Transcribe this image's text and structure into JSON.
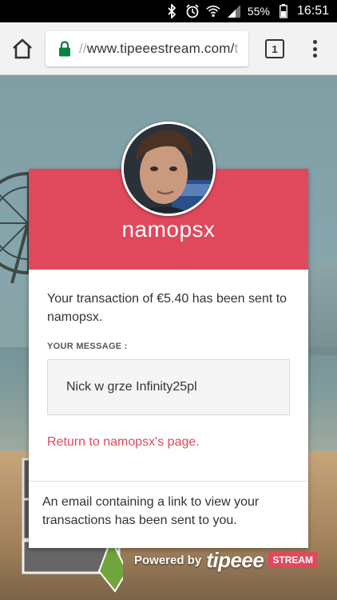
{
  "status_bar": {
    "battery": "55%",
    "time": "16:51",
    "icons": [
      "bluetooth-icon",
      "alarm-icon",
      "wifi-icon",
      "signal-icon",
      "battery-icon"
    ]
  },
  "browser": {
    "url_prefix": "//",
    "url": "www.tipeeestream.com/",
    "url_fade": "t",
    "tab_count": "1"
  },
  "card": {
    "streamer_name": "namopsx",
    "transaction_text": "Your transaction of €5.40 has been sent to namopsx.",
    "message_label": "YOUR MESSAGE :",
    "message": "Nick w grze Infinity25pl",
    "return_link": "Return to namopsx's page.",
    "email_notice": "An email containing a link to view your transactions has been sent to you."
  },
  "footer": {
    "powered_by": "Powered by",
    "brand_main": "tipeee",
    "brand_stream": "STREAM"
  },
  "colors": {
    "accent": "#e0485c"
  }
}
